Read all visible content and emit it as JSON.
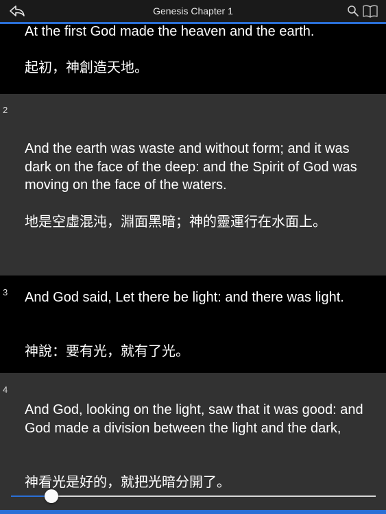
{
  "header": {
    "title": "Genesis Chapter 1"
  },
  "icons": {
    "back": "back-arrow-icon",
    "search": "search-icon",
    "book": "book-icon"
  },
  "colors": {
    "accent": "#2a6fd6",
    "header_bg": "#1a1a1a",
    "verse_dark_bg": "#000000",
    "verse_gray_bg": "#323232"
  },
  "verses": [
    {
      "number": "",
      "english": "At the first God made the heaven and the earth.",
      "chinese": "起初，神創造天地。"
    },
    {
      "number": "2",
      "english": "And the earth was waste and without form; and it was dark on the face of the deep: and the Spirit of God was moving on the face of the waters.",
      "chinese": "地是空虛混沌，淵面黑暗；神的靈運行在水面上。"
    },
    {
      "number": "3",
      "english": "And God said, Let there be light: and there was light.",
      "chinese": "神說：要有光，就有了光。"
    },
    {
      "number": "4",
      "english": "And God, looking on the light, saw that it was good: and God made a division between the light and the dark,",
      "chinese": "神看光是好的，就把光暗分開了。"
    }
  ],
  "scroll_slider": {
    "position_fraction": 0.11
  }
}
